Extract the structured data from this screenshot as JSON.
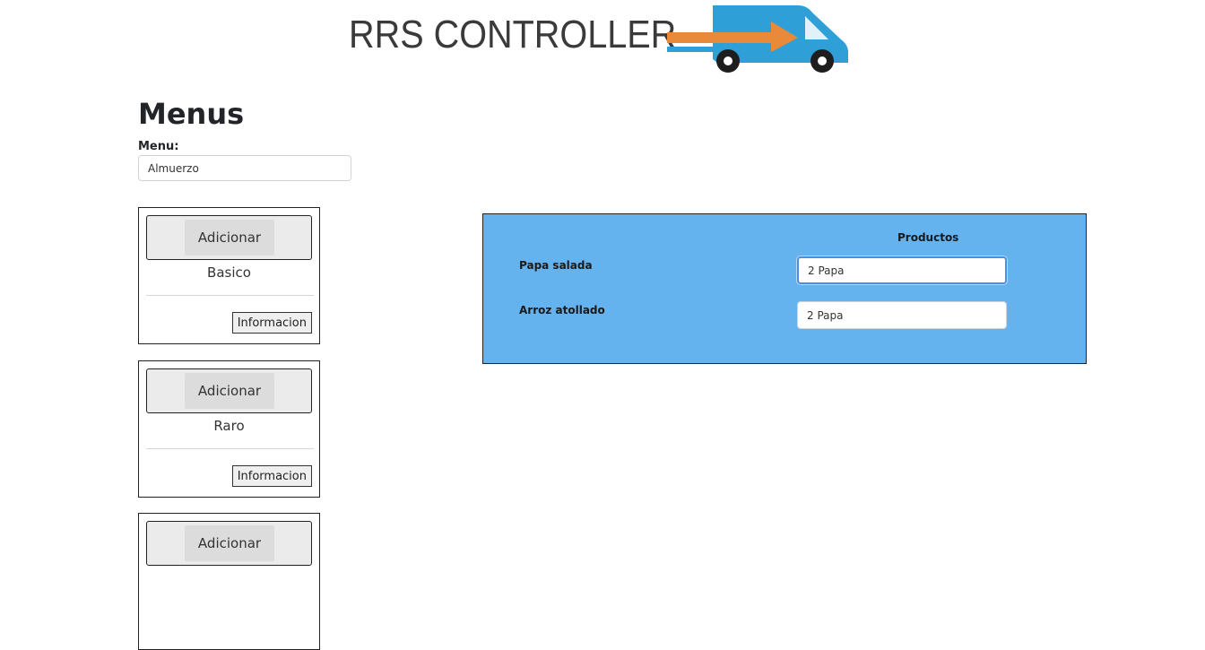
{
  "brand": {
    "name": "RRS CONTROLLER",
    "colors": {
      "arrow": "#e98a3a",
      "truck": "#2f9fd8"
    }
  },
  "page": {
    "title": "Menus"
  },
  "menu_field": {
    "label": "Menu:",
    "value": "Almuerzo"
  },
  "cards": [
    {
      "add_label": "Adicionar",
      "name": "Basico",
      "info_label": "Informacion"
    },
    {
      "add_label": "Adicionar",
      "name": "Raro",
      "info_label": "Informacion"
    },
    {
      "add_label": "Adicionar",
      "name": "",
      "info_label": ""
    }
  ],
  "products_panel": {
    "header": "Productos",
    "background": "#64b2ee",
    "rows": [
      {
        "label": "Papa salada",
        "value": "2 Papa"
      },
      {
        "label": "Arroz atollado",
        "value": "2 Papa"
      }
    ]
  }
}
